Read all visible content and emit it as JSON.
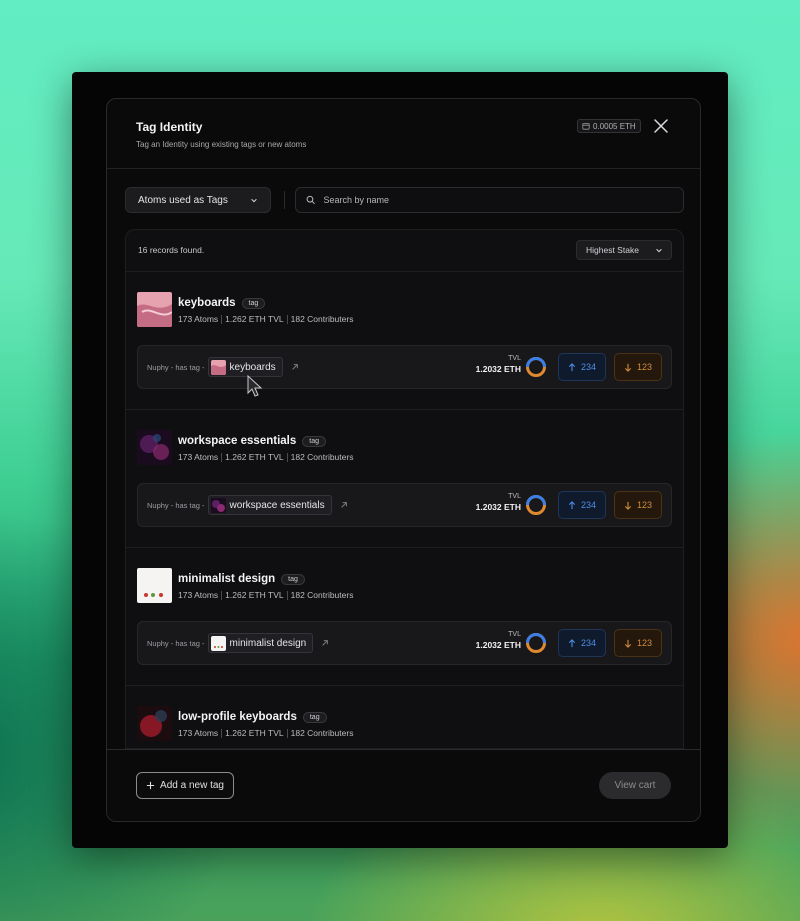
{
  "modal": {
    "title": "Tag Identity",
    "subtitle": "Tag an Identity using existing tags or new atoms",
    "cost": "0.0005 ETH"
  },
  "toolbar": {
    "filter_label": "Atoms used as Tags",
    "search_placeholder": "Search by name"
  },
  "results": {
    "count_text": "16 records found.",
    "sort_label": "Highest Stake"
  },
  "records": [
    {
      "title": "keyboards",
      "tag": "tag",
      "atoms": "173 Atoms",
      "tvl": "1.262 ETH TVL",
      "contributors": "182 Contributers",
      "claim_prefix": "Nuphy - has tag -",
      "claim_name": "keyboards",
      "tvl_label": "TVL",
      "tvl_value": "1.2032 ETH",
      "up_count": "234",
      "down_count": "123"
    },
    {
      "title": "workspace essentials",
      "tag": "tag",
      "atoms": "173 Atoms",
      "tvl": "1.262 ETH TVL",
      "contributors": "182 Contributers",
      "claim_prefix": "Nuphy - has tag -",
      "claim_name": "workspace essentials",
      "tvl_label": "TVL",
      "tvl_value": "1.2032 ETH",
      "up_count": "234",
      "down_count": "123"
    },
    {
      "title": "minimalist design",
      "tag": "tag",
      "atoms": "173 Atoms",
      "tvl": "1.262 ETH TVL",
      "contributors": "182 Contributers",
      "claim_prefix": "Nuphy - has tag -",
      "claim_name": "minimalist design",
      "tvl_label": "TVL",
      "tvl_value": "1.2032 ETH",
      "up_count": "234",
      "down_count": "123"
    },
    {
      "title": "low-profile keyboards",
      "tag": "tag",
      "atoms": "173 Atoms",
      "tvl": "1.262 ETH TVL",
      "contributors": "182 Contributers"
    }
  ],
  "footer": {
    "add_tag_label": "Add a new tag",
    "view_cart_label": "View cart"
  },
  "colors": {
    "vote_up": "#4d8ee8",
    "vote_down": "#d28d3d",
    "ring_blue": "#3b7fe6",
    "ring_orange": "#e0892e"
  },
  "icons": {
    "close": "close-icon",
    "wallet": "wallet-icon",
    "chevron": "chevron-down-icon",
    "search": "search-icon",
    "external": "external-link-icon",
    "arrow_up": "arrow-up-icon",
    "arrow_down": "arrow-down-icon",
    "plus": "plus-icon"
  }
}
